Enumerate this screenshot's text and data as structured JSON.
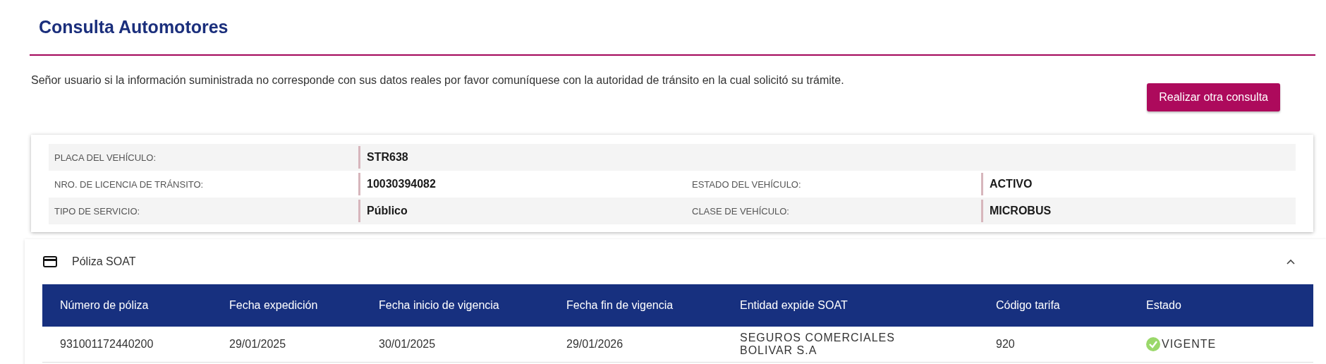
{
  "page_title": "Consulta Automotores",
  "notice": "Señor usuario si la información suministrada no corresponde con sus datos reales por favor comuníquese con la autoridad de tránsito en la cual solicitó su trámite.",
  "action_button": "Realizar otra consulta",
  "vehicle_info": [
    [
      {
        "label": "PLACA DEL VEHÍCULO:",
        "value": "STR638"
      }
    ],
    [
      {
        "label": "NRO. DE LICENCIA DE TRÁNSITO:",
        "value": "10030394082"
      },
      {
        "label": "ESTADO DEL VEHÍCULO:",
        "value": "ACTIVO"
      }
    ],
    [
      {
        "label": "TIPO DE SERVICIO:",
        "value": "Público"
      },
      {
        "label": "CLASE DE VEHÍCULO:",
        "value": "MICROBUS"
      }
    ]
  ],
  "soat_panel": {
    "title": "Póliza SOAT",
    "expanded": true,
    "table": {
      "columns": [
        "Número de póliza",
        "Fecha expedición",
        "Fecha inicio de vigencia",
        "Fecha fin de vigencia",
        "Entidad expide SOAT",
        "Código tarifa",
        "Estado"
      ],
      "rows": [
        {
          "cells": [
            "931001172440200",
            "29/01/2025",
            "30/01/2025",
            "29/01/2026",
            "SEGUROS COMERCIALES BOLIVAR S.A",
            "920"
          ],
          "status": {
            "text": "VIGENTE",
            "kind": "valid"
          }
        }
      ]
    }
  }
}
